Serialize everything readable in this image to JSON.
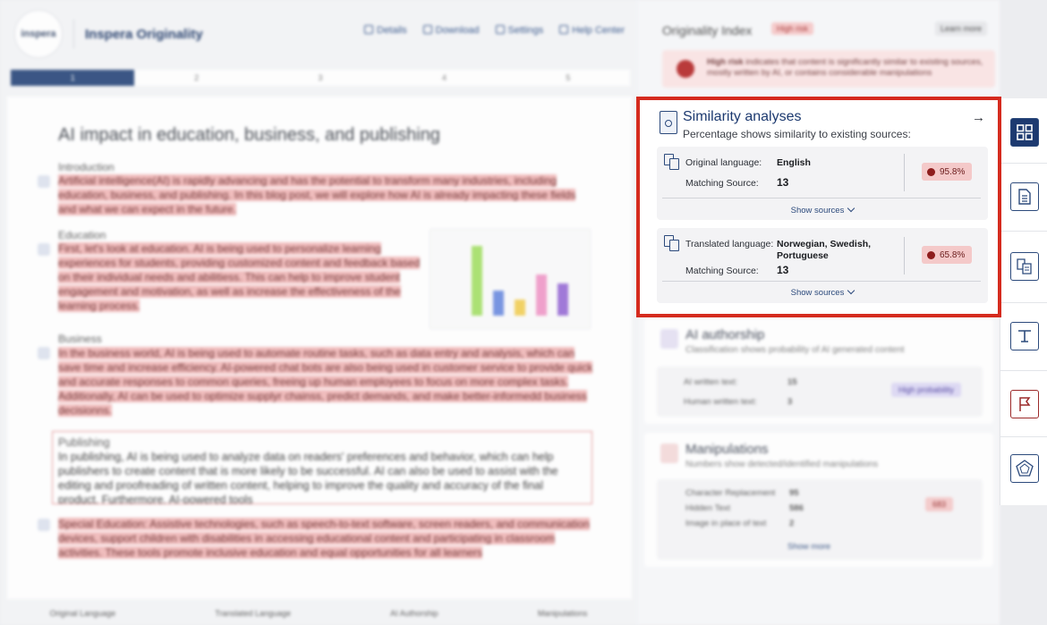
{
  "app": {
    "logo_text": "inspera",
    "brand": "Inspera Originality",
    "actions": [
      "Details",
      "Download",
      "Settings",
      "Help Center"
    ]
  },
  "pager": [
    "1",
    "2",
    "3",
    "4",
    "5"
  ],
  "document": {
    "title": "AI impact in education, business, and publishing",
    "sections": [
      {
        "heading": "Introduction",
        "text": "Artificial intelligence(AI) is rapidly advancing and has the potential to transform many industries, including education, business, and publishing. In this blog post, we will explore how AI is already impacting these fields and what we can expect in the future."
      },
      {
        "heading": "Education",
        "text": "First, let's look at education. AI is being used to personalize learning experiences for students, providing customized content and feedback based on their individual needs and abilitiess. This can help to improve student engagement and motivation, as well as increase the effectiveness of the learning process."
      },
      {
        "heading": "Business",
        "text": "In the business world, AI is being used to automate routine tasks, such as data entry and analysis, which can save time and increase efficiency. AI-powered chat bots are also being used in customer service to provide quick and accurate responses to common queries, freeing up human employees to focus on more complex tasks. Additionally, AI can be used to optimize supplyr chainss, predict demands, and make better-informedd business decisionns."
      },
      {
        "heading": "Publishing",
        "text": "In publishing, AI is being used to analyze data on readers' preferences and behavior, which can help publishers to create content that is more likely to be successful. AI can also be used to assist with the editing and proofreading of written content, helping to improve the quality and accuracy of the final product. Furthermore, AI-powered tools"
      },
      {
        "heading": "",
        "text": "Special Education: Assistive technologies, such as speech-to-text software, screen readers, and communication devices, support children with disabilities in accessing educational content and participating in classroom activities. These tools promote inclusive education and equal opportunities for all learners"
      }
    ]
  },
  "bottom_tabs": [
    "Original Language",
    "Translated Language",
    "AI Authorship",
    "Manipulations"
  ],
  "originality": {
    "title": "Originality Index",
    "badge": "High risk",
    "learn_more": "Learn more",
    "risk_bold": "High risk",
    "risk_text": "indicates that content is significantly similar to existing sources, mostly written by AI, or contains considerable manipulations"
  },
  "similarity": {
    "title": "Similarity analyses",
    "subtitle": "Percentage shows similarity to existing sources:",
    "arrow": "→",
    "original": {
      "label": "Original language:",
      "value": "English",
      "matching_label": "Matching Source:",
      "matching_value": "13",
      "percent": "95.8%",
      "show_sources": "Show sources"
    },
    "translated": {
      "label": "Translated language:",
      "value": "Norwegian, Swedish, Portuguese",
      "matching_label": "Matching Source:",
      "matching_value": "13",
      "percent": "65.8%",
      "show_sources": "Show sources"
    }
  },
  "ai_authorship": {
    "title": "AI authorship",
    "subtitle": "Classification shows probability of AI generated content",
    "ai_label": "AI written text:",
    "ai_value": "15",
    "human_label": "Human written text:",
    "human_value": "3",
    "badge": "High probability"
  },
  "manipulations": {
    "title": "Manipulations",
    "subtitle": "Numbers show detected/identified manipulations",
    "rows": [
      {
        "label": "Character Replacement",
        "value": "95"
      },
      {
        "label": "Hidden Text",
        "value": "586"
      },
      {
        "label": "Image in place of text",
        "value": "2"
      }
    ],
    "badge": "683",
    "show_more": "Show more"
  },
  "colors": {
    "highlight_border": "#d52b1e",
    "brand_navy": "#1d3a70",
    "risk_red": "#8e1d1d"
  }
}
